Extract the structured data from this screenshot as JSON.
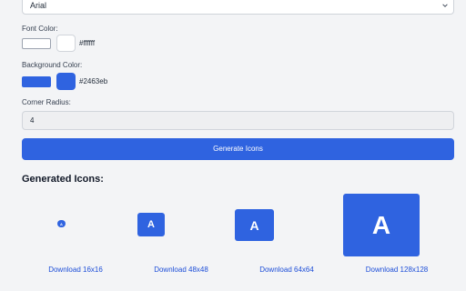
{
  "font_select": {
    "value": "Arial"
  },
  "font_color": {
    "label": "Font Color:",
    "hex": "#ffffff",
    "swatch": "#ffffff"
  },
  "background_color": {
    "label": "Background Color:",
    "hex": "#2463eb",
    "swatch": "#2f63e0"
  },
  "corner_radius": {
    "label": "Corner Radius:",
    "value": "4"
  },
  "generate_button": {
    "label": "Generate Icons"
  },
  "generated": {
    "title": "Generated Icons:",
    "icons": [
      {
        "glyph": "A",
        "download": "Download 16x16"
      },
      {
        "glyph": "A",
        "download": "Download 48x48"
      },
      {
        "glyph": "A",
        "download": "Download 64x64"
      },
      {
        "glyph": "A",
        "download": "Download 128x128"
      }
    ]
  }
}
